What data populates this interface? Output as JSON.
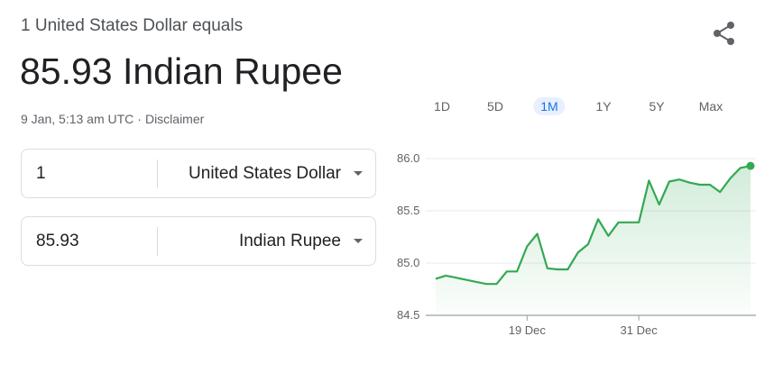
{
  "header": {
    "subtitle": "1 United States Dollar equals",
    "rate_text": "85.93 Indian Rupee",
    "timestamp": "9 Jan, 5:13 am UTC",
    "separator": "·",
    "disclaimer": "Disclaimer",
    "share_icon": "share-icon"
  },
  "converter": {
    "from": {
      "amount": "1",
      "currency": "United States Dollar"
    },
    "to": {
      "amount": "85.93",
      "currency": "Indian Rupee"
    }
  },
  "ranges": [
    {
      "label": "1D",
      "active": false
    },
    {
      "label": "5D",
      "active": false
    },
    {
      "label": "1M",
      "active": true
    },
    {
      "label": "1Y",
      "active": false
    },
    {
      "label": "5Y",
      "active": false
    },
    {
      "label": "Max",
      "active": false
    }
  ],
  "colors": {
    "line": "#34a853",
    "active_range": "#1a73e8",
    "active_range_bg": "#e8f0fe",
    "grid": "#e8eaed"
  },
  "chart_data": {
    "type": "line",
    "ylim": [
      84.5,
      86.0
    ],
    "yticks": [
      "86.0",
      "85.5",
      "85.0",
      "84.5"
    ],
    "xticks": [
      "19 Dec",
      "31 Dec"
    ],
    "series": [
      {
        "values": [
          84.85,
          84.88,
          84.86,
          84.84,
          84.82,
          84.8,
          84.8,
          84.92,
          84.92,
          85.16,
          85.28,
          84.95,
          84.94,
          84.94,
          85.1,
          85.18,
          85.42,
          85.26,
          85.39,
          85.39,
          85.39,
          85.79,
          85.56,
          85.78,
          85.8,
          85.77,
          85.75,
          85.75,
          85.68,
          85.81,
          85.91,
          85.93
        ]
      }
    ],
    "grid": true
  }
}
